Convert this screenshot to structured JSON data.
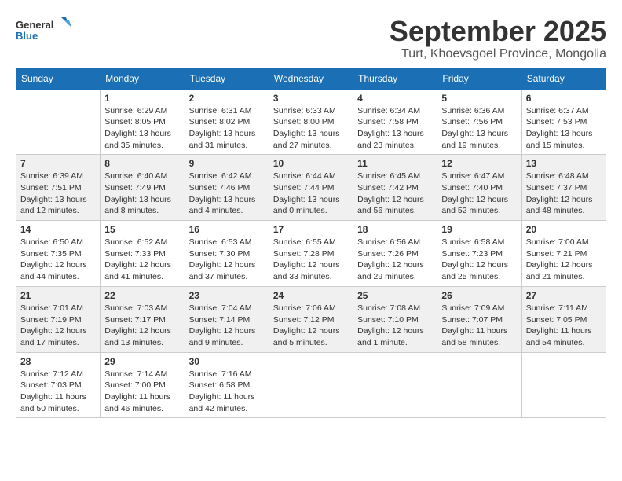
{
  "logo": {
    "general": "General",
    "blue": "Blue"
  },
  "title": "September 2025",
  "location": "Turt, Khoevsgoel Province, Mongolia",
  "days_of_week": [
    "Sunday",
    "Monday",
    "Tuesday",
    "Wednesday",
    "Thursday",
    "Friday",
    "Saturday"
  ],
  "weeks": [
    [
      {
        "day": "",
        "detail": ""
      },
      {
        "day": "1",
        "detail": "Sunrise: 6:29 AM\nSunset: 8:05 PM\nDaylight: 13 hours\nand 35 minutes."
      },
      {
        "day": "2",
        "detail": "Sunrise: 6:31 AM\nSunset: 8:02 PM\nDaylight: 13 hours\nand 31 minutes."
      },
      {
        "day": "3",
        "detail": "Sunrise: 6:33 AM\nSunset: 8:00 PM\nDaylight: 13 hours\nand 27 minutes."
      },
      {
        "day": "4",
        "detail": "Sunrise: 6:34 AM\nSunset: 7:58 PM\nDaylight: 13 hours\nand 23 minutes."
      },
      {
        "day": "5",
        "detail": "Sunrise: 6:36 AM\nSunset: 7:56 PM\nDaylight: 13 hours\nand 19 minutes."
      },
      {
        "day": "6",
        "detail": "Sunrise: 6:37 AM\nSunset: 7:53 PM\nDaylight: 13 hours\nand 15 minutes."
      }
    ],
    [
      {
        "day": "7",
        "detail": "Sunrise: 6:39 AM\nSunset: 7:51 PM\nDaylight: 13 hours\nand 12 minutes."
      },
      {
        "day": "8",
        "detail": "Sunrise: 6:40 AM\nSunset: 7:49 PM\nDaylight: 13 hours\nand 8 minutes."
      },
      {
        "day": "9",
        "detail": "Sunrise: 6:42 AM\nSunset: 7:46 PM\nDaylight: 13 hours\nand 4 minutes."
      },
      {
        "day": "10",
        "detail": "Sunrise: 6:44 AM\nSunset: 7:44 PM\nDaylight: 13 hours\nand 0 minutes."
      },
      {
        "day": "11",
        "detail": "Sunrise: 6:45 AM\nSunset: 7:42 PM\nDaylight: 12 hours\nand 56 minutes."
      },
      {
        "day": "12",
        "detail": "Sunrise: 6:47 AM\nSunset: 7:40 PM\nDaylight: 12 hours\nand 52 minutes."
      },
      {
        "day": "13",
        "detail": "Sunrise: 6:48 AM\nSunset: 7:37 PM\nDaylight: 12 hours\nand 48 minutes."
      }
    ],
    [
      {
        "day": "14",
        "detail": "Sunrise: 6:50 AM\nSunset: 7:35 PM\nDaylight: 12 hours\nand 44 minutes."
      },
      {
        "day": "15",
        "detail": "Sunrise: 6:52 AM\nSunset: 7:33 PM\nDaylight: 12 hours\nand 41 minutes."
      },
      {
        "day": "16",
        "detail": "Sunrise: 6:53 AM\nSunset: 7:30 PM\nDaylight: 12 hours\nand 37 minutes."
      },
      {
        "day": "17",
        "detail": "Sunrise: 6:55 AM\nSunset: 7:28 PM\nDaylight: 12 hours\nand 33 minutes."
      },
      {
        "day": "18",
        "detail": "Sunrise: 6:56 AM\nSunset: 7:26 PM\nDaylight: 12 hours\nand 29 minutes."
      },
      {
        "day": "19",
        "detail": "Sunrise: 6:58 AM\nSunset: 7:23 PM\nDaylight: 12 hours\nand 25 minutes."
      },
      {
        "day": "20",
        "detail": "Sunrise: 7:00 AM\nSunset: 7:21 PM\nDaylight: 12 hours\nand 21 minutes."
      }
    ],
    [
      {
        "day": "21",
        "detail": "Sunrise: 7:01 AM\nSunset: 7:19 PM\nDaylight: 12 hours\nand 17 minutes."
      },
      {
        "day": "22",
        "detail": "Sunrise: 7:03 AM\nSunset: 7:17 PM\nDaylight: 12 hours\nand 13 minutes."
      },
      {
        "day": "23",
        "detail": "Sunrise: 7:04 AM\nSunset: 7:14 PM\nDaylight: 12 hours\nand 9 minutes."
      },
      {
        "day": "24",
        "detail": "Sunrise: 7:06 AM\nSunset: 7:12 PM\nDaylight: 12 hours\nand 5 minutes."
      },
      {
        "day": "25",
        "detail": "Sunrise: 7:08 AM\nSunset: 7:10 PM\nDaylight: 12 hours\nand 1 minute."
      },
      {
        "day": "26",
        "detail": "Sunrise: 7:09 AM\nSunset: 7:07 PM\nDaylight: 11 hours\nand 58 minutes."
      },
      {
        "day": "27",
        "detail": "Sunrise: 7:11 AM\nSunset: 7:05 PM\nDaylight: 11 hours\nand 54 minutes."
      }
    ],
    [
      {
        "day": "28",
        "detail": "Sunrise: 7:12 AM\nSunset: 7:03 PM\nDaylight: 11 hours\nand 50 minutes."
      },
      {
        "day": "29",
        "detail": "Sunrise: 7:14 AM\nSunset: 7:00 PM\nDaylight: 11 hours\nand 46 minutes."
      },
      {
        "day": "30",
        "detail": "Sunrise: 7:16 AM\nSunset: 6:58 PM\nDaylight: 11 hours\nand 42 minutes."
      },
      {
        "day": "",
        "detail": ""
      },
      {
        "day": "",
        "detail": ""
      },
      {
        "day": "",
        "detail": ""
      },
      {
        "day": "",
        "detail": ""
      }
    ]
  ]
}
